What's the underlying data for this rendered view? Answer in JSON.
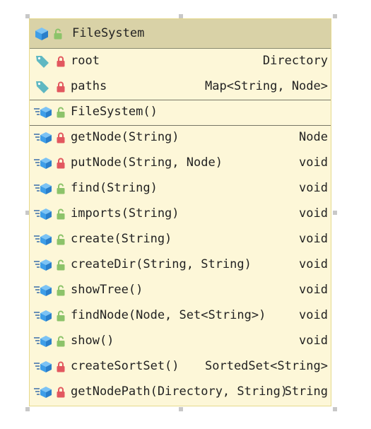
{
  "class": {
    "name": "FileSystem",
    "fields": [
      {
        "name": "root",
        "type": "Directory",
        "visibility": "private"
      },
      {
        "name": "paths",
        "type": "Map<String, Node>",
        "visibility": "private"
      }
    ],
    "constructors": [
      {
        "name": "FileSystem()",
        "type": "",
        "visibility": "public"
      }
    ],
    "methods": [
      {
        "name": "getNode(String)",
        "type": "Node",
        "visibility": "private"
      },
      {
        "name": "putNode(String, Node)",
        "type": "void",
        "visibility": "private"
      },
      {
        "name": "find(String)",
        "type": "void",
        "visibility": "public"
      },
      {
        "name": "imports(String)",
        "type": "void",
        "visibility": "public"
      },
      {
        "name": "create(String)",
        "type": "void",
        "visibility": "public"
      },
      {
        "name": "createDir(String, String)",
        "type": "void",
        "visibility": "public"
      },
      {
        "name": "showTree()",
        "type": "void",
        "visibility": "public"
      },
      {
        "name": "findNode(Node, Set<String>)",
        "type": "void",
        "visibility": "public"
      },
      {
        "name": "show()",
        "type": "void",
        "visibility": "public"
      },
      {
        "name": "createSortSet()",
        "type": "SortedSet<String>",
        "visibility": "private"
      },
      {
        "name": "getNodePath(Directory, String)",
        "type": "String",
        "visibility": "private"
      }
    ]
  },
  "icons": {
    "class": "class-cube-icon",
    "field": "field-tag-icon",
    "method": "method-icon",
    "private": "lock-closed-red-icon",
    "public": "lock-open-green-icon"
  },
  "colors": {
    "card_background": "#fdf7d8",
    "header_background": "#d9d2a7",
    "card_border": "#e6d98c",
    "private_lock": "#e2585f",
    "public_lock": "#8cc36a",
    "cube_blue": "#3e9ee8",
    "tag_teal": "#5fb8c2"
  }
}
